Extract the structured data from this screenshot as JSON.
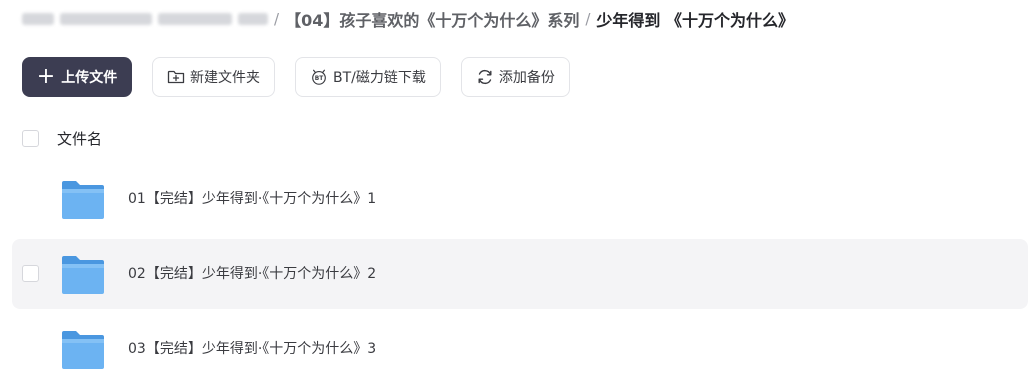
{
  "breadcrumb": {
    "parent": "【04】孩子喜欢的《十万个为什么》系列",
    "current": "少年得到 《十万个为什么》",
    "separator": "/"
  },
  "toolbar": {
    "upload_plus": "+",
    "upload_label": "上传文件",
    "new_folder_label": "新建文件夹",
    "bt_label": "BT/磁力链下载",
    "backup_label": "添加备份"
  },
  "list": {
    "header_label": "文件名",
    "items": [
      {
        "name": "01【完结】少年得到·《十万个为什么》1"
      },
      {
        "name": "02【完结】少年得到·《十万个为什么》2"
      },
      {
        "name": "03【完结】少年得到·《十万个为什么》3"
      }
    ]
  },
  "colors": {
    "primary_button": "#3c3d52",
    "folder": "#5aa6ec",
    "row_hover": "#f4f4f6"
  },
  "icons": [
    "folder-plus-icon",
    "bt-icon",
    "sync-icon",
    "folder-icon"
  ]
}
